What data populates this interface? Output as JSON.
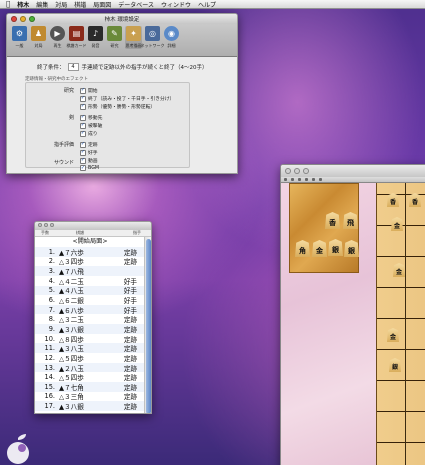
{
  "menubar": {
    "app_name": "柿木",
    "items": [
      "編集",
      "対局",
      "棋譜",
      "局面図",
      "データベース",
      "ウィンドウ",
      "ヘルプ"
    ]
  },
  "prefs_window": {
    "title": "柿木 環境設定",
    "toolbar": [
      "一般",
      "対局",
      "再生",
      "棋譜カード",
      "発音",
      "研究",
      "思考描画",
      "ネットワーク",
      "詳細"
    ],
    "end_condition": {
      "label": "終了条件：",
      "value": "4",
      "suffix": "手連続で定跡以外の指手が続くと終了（4〜20手）"
    },
    "section_title": "定跡情報・研究中のエフェクト",
    "groups": [
      {
        "label": "研究",
        "options": [
          "開始",
          "終了（読み・投了・千日手・引き分け）",
          "形勢（優勢・勝勢・形勢逆転）"
        ]
      },
      {
        "label": "剣",
        "options": [
          "移動先",
          "被撃破",
          "成り"
        ]
      },
      {
        "label": "指手評価",
        "options": [
          "定跡",
          "好手"
        ]
      },
      {
        "label": "サウンド",
        "options": [
          "動画",
          "BGM"
        ]
      }
    ]
  },
  "kifu_window": {
    "columns": [
      "手数",
      "棋譜",
      "指手"
    ],
    "start_label": "<開始局面>",
    "moves": [
      {
        "num": "1.",
        "move": "▲７六歩",
        "comment": "定跡"
      },
      {
        "num": "2.",
        "move": "△３四歩",
        "comment": "定跡"
      },
      {
        "num": "3.",
        "move": "▲７八飛",
        "comment": ""
      },
      {
        "num": "4.",
        "move": "△４二玉",
        "comment": "好手"
      },
      {
        "num": "5.",
        "move": "▲４八玉",
        "comment": "好手"
      },
      {
        "num": "6.",
        "move": "△６二銀",
        "comment": "好手"
      },
      {
        "num": "7.",
        "move": "▲６八歩",
        "comment": "好手"
      },
      {
        "num": "8.",
        "move": "△３二玉",
        "comment": "定跡"
      },
      {
        "num": "9.",
        "move": "▲３八銀",
        "comment": "定跡"
      },
      {
        "num": "10.",
        "move": "△８四歩",
        "comment": "定跡"
      },
      {
        "num": "11.",
        "move": "▲３八玉",
        "comment": "定跡"
      },
      {
        "num": "12.",
        "move": "△５四歩",
        "comment": "定跡"
      },
      {
        "num": "13.",
        "move": "▲２八玉",
        "comment": "定跡"
      },
      {
        "num": "14.",
        "move": "△５四歩",
        "comment": "定跡"
      },
      {
        "num": "15.",
        "move": "▲７七角",
        "comment": "定跡"
      },
      {
        "num": "16.",
        "move": "△３三角",
        "comment": "定跡"
      },
      {
        "num": "17.",
        "move": "▲３八銀",
        "comment": "定跡"
      },
      {
        "num": "18.",
        "move": "△２二玉",
        "comment": "定跡"
      }
    ]
  },
  "board": {
    "hand_pieces": [
      "香",
      "飛",
      "角",
      "金",
      "銀",
      "銀",
      "金",
      "銀"
    ],
    "board_pieces": [
      "香",
      "香",
      "金",
      "金",
      "金",
      "銀"
    ]
  },
  "colors": {
    "accent": "#1a4fa8"
  }
}
